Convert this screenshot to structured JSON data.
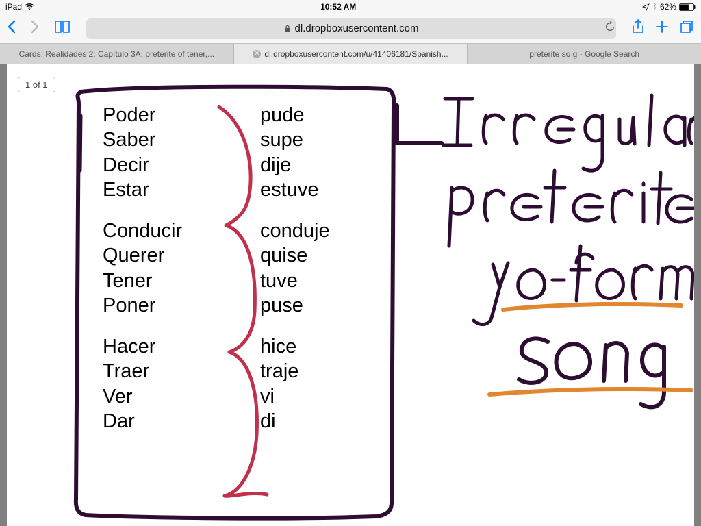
{
  "status": {
    "device": "iPad",
    "time": "10:52 AM",
    "battery_pct": "62%"
  },
  "toolbar": {
    "url": "dl.dropboxusercontent.com"
  },
  "tabs": [
    {
      "label": "Cards: Realidades 2: Capítulo 3A: preterite of tener,..."
    },
    {
      "label": "dl.dropboxusercontent.com/u/41406181/Spanish..."
    },
    {
      "label": "preterite so g - Google Search"
    }
  ],
  "page_counter": "1 of 1",
  "verbs": {
    "group1": [
      {
        "inf": "Poder",
        "conj": "pude"
      },
      {
        "inf": "Saber",
        "conj": "supe"
      },
      {
        "inf": "Decir",
        "conj": "dije"
      },
      {
        "inf": "Estar",
        "conj": "estuve"
      }
    ],
    "group2": [
      {
        "inf": "Conducir",
        "conj": "conduje"
      },
      {
        "inf": "Querer",
        "conj": "quise"
      },
      {
        "inf": "Tener",
        "conj": "tuve"
      },
      {
        "inf": "Poner",
        "conj": "puse"
      }
    ],
    "group3": [
      {
        "inf": "Hacer",
        "conj": "hice"
      },
      {
        "inf": "Traer",
        "conj": "traje"
      },
      {
        "inf": "Ver",
        "conj": "vi"
      },
      {
        "inf": "Dar",
        "conj": "di"
      }
    ]
  },
  "handwriting": {
    "line1": "Irregular",
    "line2": "preterite",
    "line3": "yo-form",
    "line4": "song"
  },
  "colors": {
    "ink_purple": "#2e0d33",
    "ink_red": "#c1314b",
    "ink_orange": "#e0872f"
  }
}
